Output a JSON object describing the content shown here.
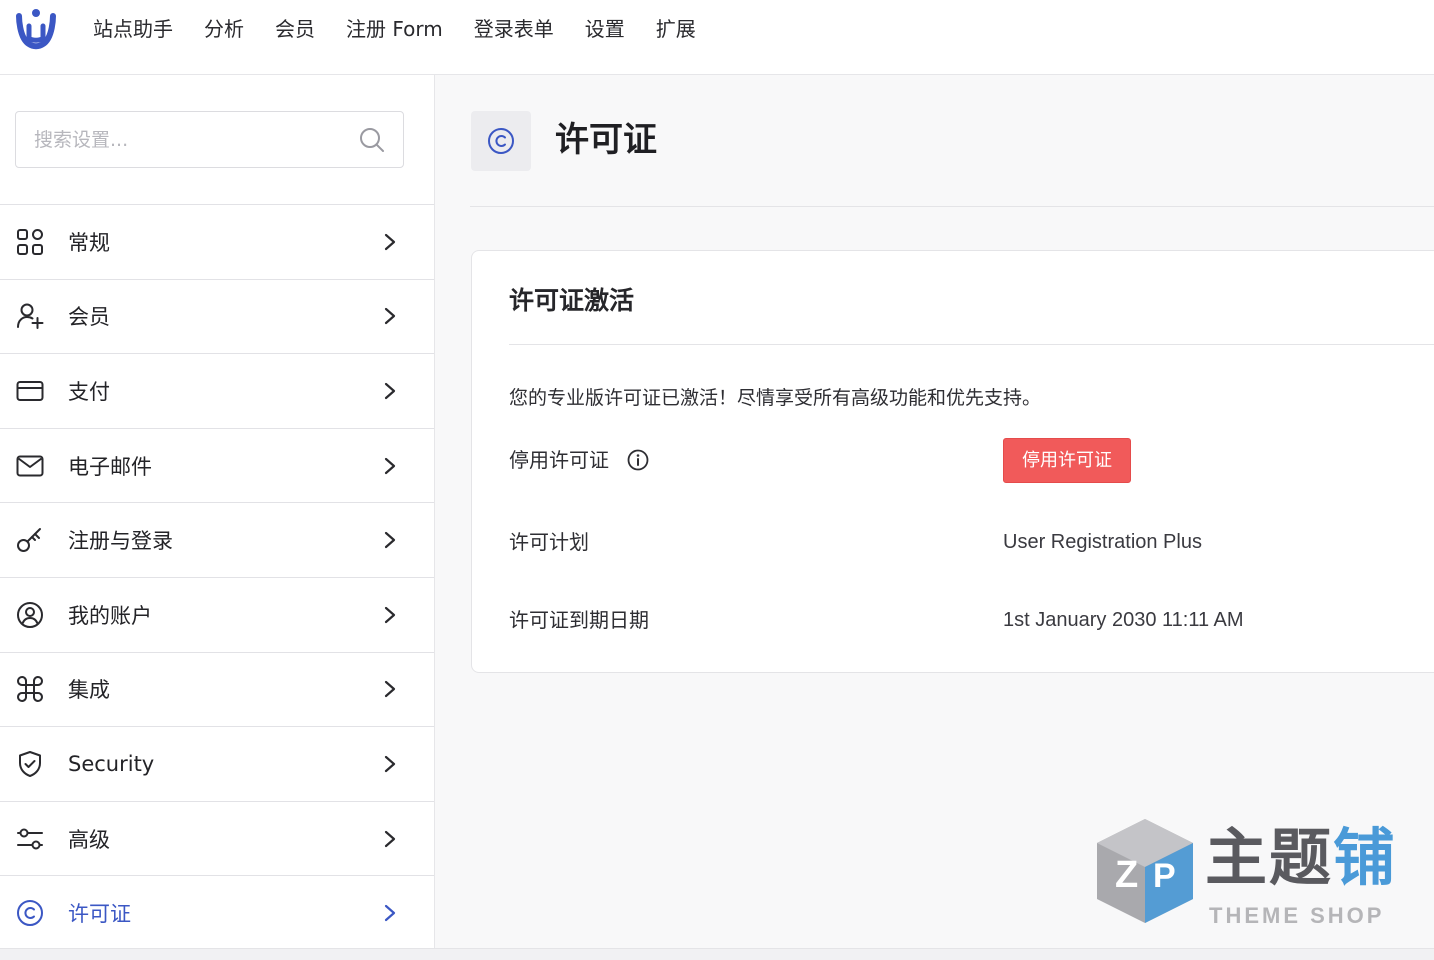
{
  "topnav": {
    "items": [
      {
        "label": "站点助手"
      },
      {
        "label": "分析"
      },
      {
        "label": "会员"
      },
      {
        "label": "注册 Form"
      },
      {
        "label": "登录表单"
      },
      {
        "label": "设置"
      },
      {
        "label": "扩展"
      }
    ]
  },
  "sidebar": {
    "search": {
      "placeholder": "搜索设置...",
      "value": ""
    },
    "items": [
      {
        "label": "常规",
        "icon": "grid-icon"
      },
      {
        "label": "会员",
        "icon": "user-plus-icon"
      },
      {
        "label": "支付",
        "icon": "credit-card-icon"
      },
      {
        "label": "电子邮件",
        "icon": "mail-icon"
      },
      {
        "label": "注册与登录",
        "icon": "key-icon"
      },
      {
        "label": "我的账户",
        "icon": "user-circle-icon"
      },
      {
        "label": "集成",
        "icon": "command-icon"
      },
      {
        "label": "Security",
        "icon": "shield-icon"
      },
      {
        "label": "高级",
        "icon": "sliders-icon"
      },
      {
        "label": "许可证",
        "icon": "copyright-icon",
        "active": true
      }
    ]
  },
  "main": {
    "title": "许可证",
    "title_icon": "copyright-icon",
    "card": {
      "title": "许可证激活",
      "message": "您的专业版许可证已激活！尽情享受所有高级功能和优先支持。",
      "deactivate_label": "停用许可证",
      "deactivate_button": "停用许可证",
      "plan_label": "许可计划",
      "plan_value": "User Registration Plus",
      "expiry_label": "许可证到期日期",
      "expiry_value": "1st January 2030 11:11 AM"
    }
  },
  "watermark": {
    "zh_grey": "主题",
    "zh_blue": "铺",
    "en": "THEME SHOP"
  },
  "colors": {
    "accent": "#3b57c4",
    "danger": "#f15a5a",
    "logo": "#3b57c4"
  }
}
